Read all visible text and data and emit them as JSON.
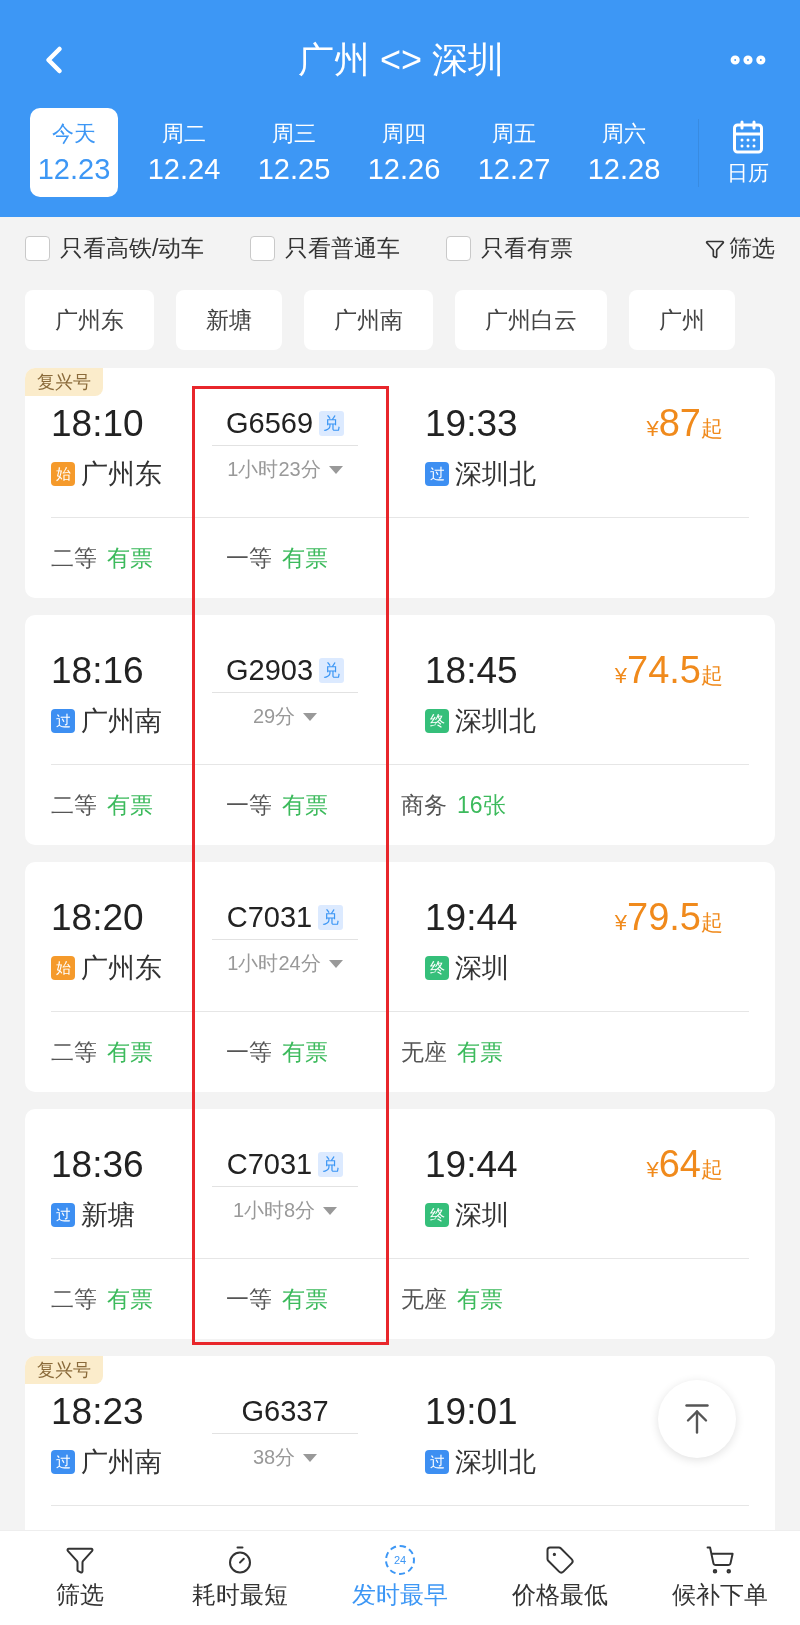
{
  "header": {
    "title": "广州 <> 深圳",
    "dates": [
      {
        "weekday": "今天",
        "date": "12.23",
        "selected": true
      },
      {
        "weekday": "周二",
        "date": "12.24",
        "selected": false
      },
      {
        "weekday": "周三",
        "date": "12.25",
        "selected": false
      },
      {
        "weekday": "周四",
        "date": "12.26",
        "selected": false
      },
      {
        "weekday": "周五",
        "date": "12.27",
        "selected": false
      },
      {
        "weekday": "周六",
        "date": "12.28",
        "selected": false
      }
    ],
    "calendar_label": "日历"
  },
  "filters": [
    {
      "label": "只看高铁/动车",
      "checked": false
    },
    {
      "label": "只看普通车",
      "checked": false
    },
    {
      "label": "只看有票",
      "checked": false
    }
  ],
  "filter_button": "筛选",
  "stations": [
    "广州东",
    "新塘",
    "广州南",
    "广州白云",
    "广州"
  ],
  "trains": [
    {
      "badge": "复兴号",
      "depart": "18:10",
      "number": "G6569",
      "exchange": "兑",
      "duration": "1小时23分",
      "arrive": "19:33",
      "price_symbol": "¥",
      "price": "87",
      "price_suffix": "起",
      "from_tag": {
        "kind": "start",
        "text": "始"
      },
      "from": "广州东",
      "to_tag": {
        "kind": "pass",
        "text": "过"
      },
      "to": "深圳北",
      "highlighted": true,
      "seats": [
        {
          "class": "二等",
          "status": "有票"
        },
        {
          "class": "一等",
          "status": "有票"
        }
      ]
    },
    {
      "depart": "18:16",
      "number": "G2903",
      "exchange": "兑",
      "duration": "29分",
      "arrive": "18:45",
      "price_symbol": "¥",
      "price": "74.5",
      "price_suffix": "起",
      "from_tag": {
        "kind": "pass",
        "text": "过"
      },
      "from": "广州南",
      "to_tag": {
        "kind": "end",
        "text": "终"
      },
      "to": "深圳北",
      "highlighted": true,
      "seats": [
        {
          "class": "二等",
          "status": "有票"
        },
        {
          "class": "一等",
          "status": "有票"
        },
        {
          "class": "商务",
          "status": "16张"
        }
      ]
    },
    {
      "depart": "18:20",
      "number": "C7031",
      "exchange": "兑",
      "duration": "1小时24分",
      "arrive": "19:44",
      "price_symbol": "¥",
      "price": "79.5",
      "price_suffix": "起",
      "from_tag": {
        "kind": "start",
        "text": "始"
      },
      "from": "广州东",
      "to_tag": {
        "kind": "end",
        "text": "终"
      },
      "to": "深圳",
      "highlighted": true,
      "seats": [
        {
          "class": "二等",
          "status": "有票"
        },
        {
          "class": "一等",
          "status": "有票"
        },
        {
          "class": "无座",
          "status": "有票"
        }
      ]
    },
    {
      "depart": "18:36",
      "number": "C7031",
      "exchange": "兑",
      "duration": "1小时8分",
      "arrive": "19:44",
      "price_symbol": "¥",
      "price": "64",
      "price_suffix": "起",
      "from_tag": {
        "kind": "pass",
        "text": "过"
      },
      "from": "新塘",
      "to_tag": {
        "kind": "end",
        "text": "终"
      },
      "to": "深圳",
      "highlighted": true,
      "seats": [
        {
          "class": "二等",
          "status": "有票"
        },
        {
          "class": "一等",
          "status": "有票"
        },
        {
          "class": "无座",
          "status": "有票"
        }
      ]
    },
    {
      "badge": "复兴号",
      "depart": "18:23",
      "number": "G6337",
      "duration": "38分",
      "arrive": "19:01",
      "from_tag": {
        "kind": "pass",
        "text": "过"
      },
      "from": "广州南",
      "to_tag": {
        "kind": "pass",
        "text": "过"
      },
      "to": "深圳北",
      "highlighted": false
    }
  ],
  "bottom_nav": [
    {
      "kind": "filter",
      "label": "筛选",
      "selected": false
    },
    {
      "kind": "timer",
      "label": "耗时最短",
      "selected": false
    },
    {
      "kind": "clock",
      "icon_text": "24",
      "label": "发时最早",
      "selected": true
    },
    {
      "kind": "tag",
      "label": "价格最低",
      "selected": false
    },
    {
      "kind": "cart",
      "label": "候补下单",
      "selected": false
    }
  ]
}
